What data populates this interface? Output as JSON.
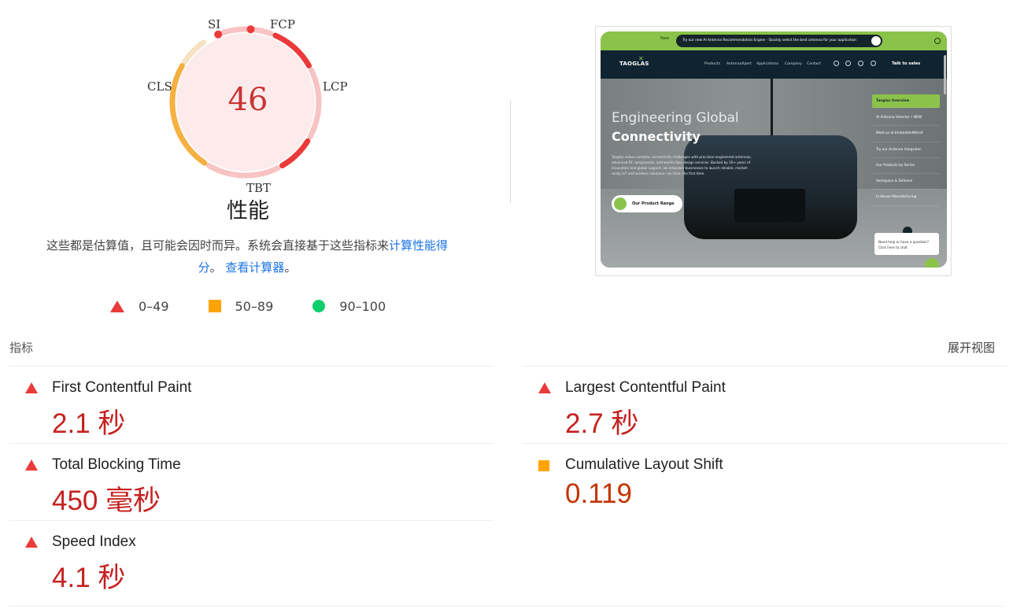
{
  "gauge": {
    "score": "46",
    "title": "性能",
    "labels": {
      "si": "SI",
      "fcp": "FCP",
      "lcp": "LCP",
      "tbt": "TBT",
      "cls": "CLS"
    }
  },
  "disclaimer": {
    "text1": "这些都是估算值，且可能会因时而异。系统会直接基于这些指标来",
    "link1": "计算性能得分",
    "text2": "。",
    "link2": "查看计算器",
    "text3": "。"
  },
  "legend": [
    {
      "range": "0–49",
      "shape": "triangle",
      "color": "#eb3a3a"
    },
    {
      "range": "50–89",
      "shape": "square",
      "color": "#ffa400"
    },
    {
      "range": "90–100",
      "shape": "circle",
      "color": "#0cce6b"
    }
  ],
  "screenshot": {
    "banner_new": "New",
    "banner_text": "Try our new AI Antenna Recommendation Engine - Quickly select the best antenna for your application",
    "logo": "TAOGLAS",
    "nav": [
      "Products",
      "AntennaXpert",
      "Applications",
      "Company",
      "Contact"
    ],
    "talk_to_sales": "Talk to sales",
    "hero_line1": "Engineering Global",
    "hero_line2": "Connectivity",
    "hero_body": "Taoglas solves complex connectivity challenges with precision-engineered antennas, advanced RF components, and world-class design services. Backed by 20+ years of innovation and global support, we empower businesses to launch reliable, market-ready IoT and wireless solutions—on time, the first time.",
    "cta": "Our Product Range",
    "side_items": [
      "Taoglas Overview",
      "AI Antenna Selector • NEW",
      "Meet us at EmbeddedWorld",
      "Try our Antenna Integrator",
      "Our Products by Series",
      "Aerospace & Defense",
      "In House Manufacturing"
    ],
    "chat_text": "Need help or have a question? Click here to chat"
  },
  "metrics_section": {
    "label": "指标",
    "expand": "展开视图"
  },
  "metrics": {
    "fcp": {
      "name": "First Contentful Paint",
      "value": "2.1 秒",
      "rating": "poor"
    },
    "lcp": {
      "name": "Largest Contentful Paint",
      "value": "2.7 秒",
      "rating": "poor"
    },
    "tbt": {
      "name": "Total Blocking Time",
      "value": "450 毫秒",
      "rating": "poor"
    },
    "cls": {
      "name": "Cumulative Layout Shift",
      "value": "0.119",
      "rating": "average"
    },
    "si": {
      "name": "Speed Index",
      "value": "4.1 秒",
      "rating": "poor"
    }
  },
  "colors": {
    "poor": "#eb3a3a",
    "average": "#ffa400",
    "good": "#0cce6b",
    "link": "#1a73e8"
  }
}
